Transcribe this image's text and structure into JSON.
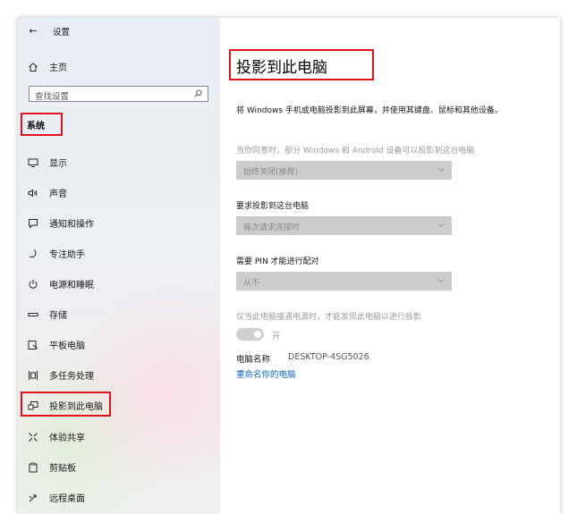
{
  "header": {
    "back_arrow": "←",
    "title": "设置"
  },
  "sidebar": {
    "home_label": "主页",
    "search_placeholder": "查找设置",
    "category": "系统",
    "items": [
      {
        "label": "显示",
        "icon": "monitor-icon"
      },
      {
        "label": "声音",
        "icon": "speaker-icon"
      },
      {
        "label": "通知和操作",
        "icon": "notification-icon"
      },
      {
        "label": "专注助手",
        "icon": "moon-icon"
      },
      {
        "label": "电源和睡眠",
        "icon": "power-icon"
      },
      {
        "label": "存储",
        "icon": "storage-icon"
      },
      {
        "label": "平板电脑",
        "icon": "tablet-icon"
      },
      {
        "label": "多任务处理",
        "icon": "multitask-icon"
      },
      {
        "label": "投影到此电脑",
        "icon": "project-icon",
        "selected": true
      },
      {
        "label": "体验共享",
        "icon": "share-icon"
      },
      {
        "label": "剪贴板",
        "icon": "clipboard-icon"
      },
      {
        "label": "远程桌面",
        "icon": "remote-desktop-icon"
      }
    ]
  },
  "main": {
    "title": "投影到此电脑",
    "description": "将 Windows 手机或电脑投影到此屏幕，并使用其键盘、鼠标和其他设备。",
    "setting1": {
      "label": "当你同意时，部分 Windows 和 Android 设备可以投影到这台电脑",
      "value": "始终关闭(推荐)"
    },
    "setting2": {
      "label": "要求投影到这台电脑",
      "value": "每次请求连接时"
    },
    "setting3": {
      "label": "需要 PIN 才能进行配对",
      "value": "从不"
    },
    "setting4": {
      "label": "仅当此电脑接通电源时，才能发现此电脑以进行投影",
      "toggle_label": "开",
      "toggle_on": true
    },
    "pc_name_label": "电脑名称",
    "pc_name_value": "DESKTOP-4SG5026",
    "rename_link": "重命名你的电脑"
  },
  "colors": {
    "highlight_box": "#e1141e",
    "link": "#0a63c9",
    "dropdown_bg": "#cccccc"
  }
}
